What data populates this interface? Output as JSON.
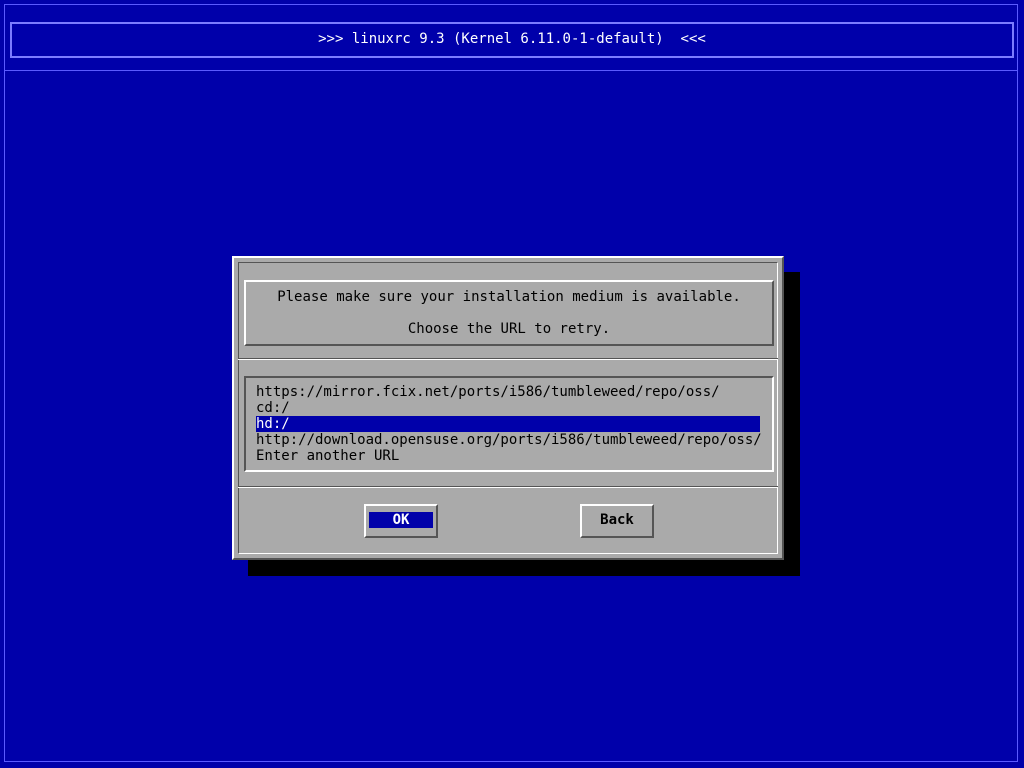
{
  "header": {
    "title": ">>> linuxrc 9.3 (Kernel 6.11.0-1-default)  <<<"
  },
  "dialog": {
    "message_line1": "Please make sure your installation medium is available.",
    "message_line2": "Choose the URL to retry.",
    "url_list": [
      "https://mirror.fcix.net/ports/i586/tumbleweed/repo/oss/",
      "cd:/",
      "hd:/",
      "http://download.opensuse.org/ports/i586/tumbleweed/repo/oss/",
      "Enter another URL"
    ],
    "selected_index": 2,
    "ok_label": "OK",
    "back_label": "Back",
    "focused_button": "OK"
  },
  "colors": {
    "background": "#0000aa",
    "dialog": "#aaaaaa",
    "selection": "#0000aa"
  }
}
